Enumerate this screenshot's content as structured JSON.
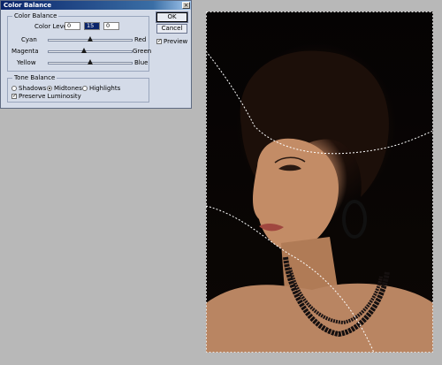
{
  "dialog": {
    "title": "Color Balance",
    "color_balance": {
      "legend": "Color Balance",
      "levels_label": "Color Levels:",
      "levels": [
        "0",
        "15",
        "0"
      ],
      "sliders": [
        {
          "left": "Cyan",
          "right": "Red",
          "value": 0
        },
        {
          "left": "Magenta",
          "right": "Green",
          "value": -15
        },
        {
          "left": "Yellow",
          "right": "Blue",
          "value": 0
        }
      ]
    },
    "tone_balance": {
      "legend": "Tone Balance",
      "options": [
        "Shadows",
        "Midtones",
        "Highlights"
      ],
      "selected": "Midtones",
      "preserve_label": "Preserve Luminosity",
      "preserve_checked": true
    },
    "buttons": {
      "ok": "OK",
      "cancel": "Cancel"
    },
    "preview_label": "Preview",
    "preview_checked": true
  },
  "colors": {
    "titlebar": "#0a246a",
    "dialog_bg": "#d4dbe8",
    "workspace": "#b8b8b8"
  }
}
